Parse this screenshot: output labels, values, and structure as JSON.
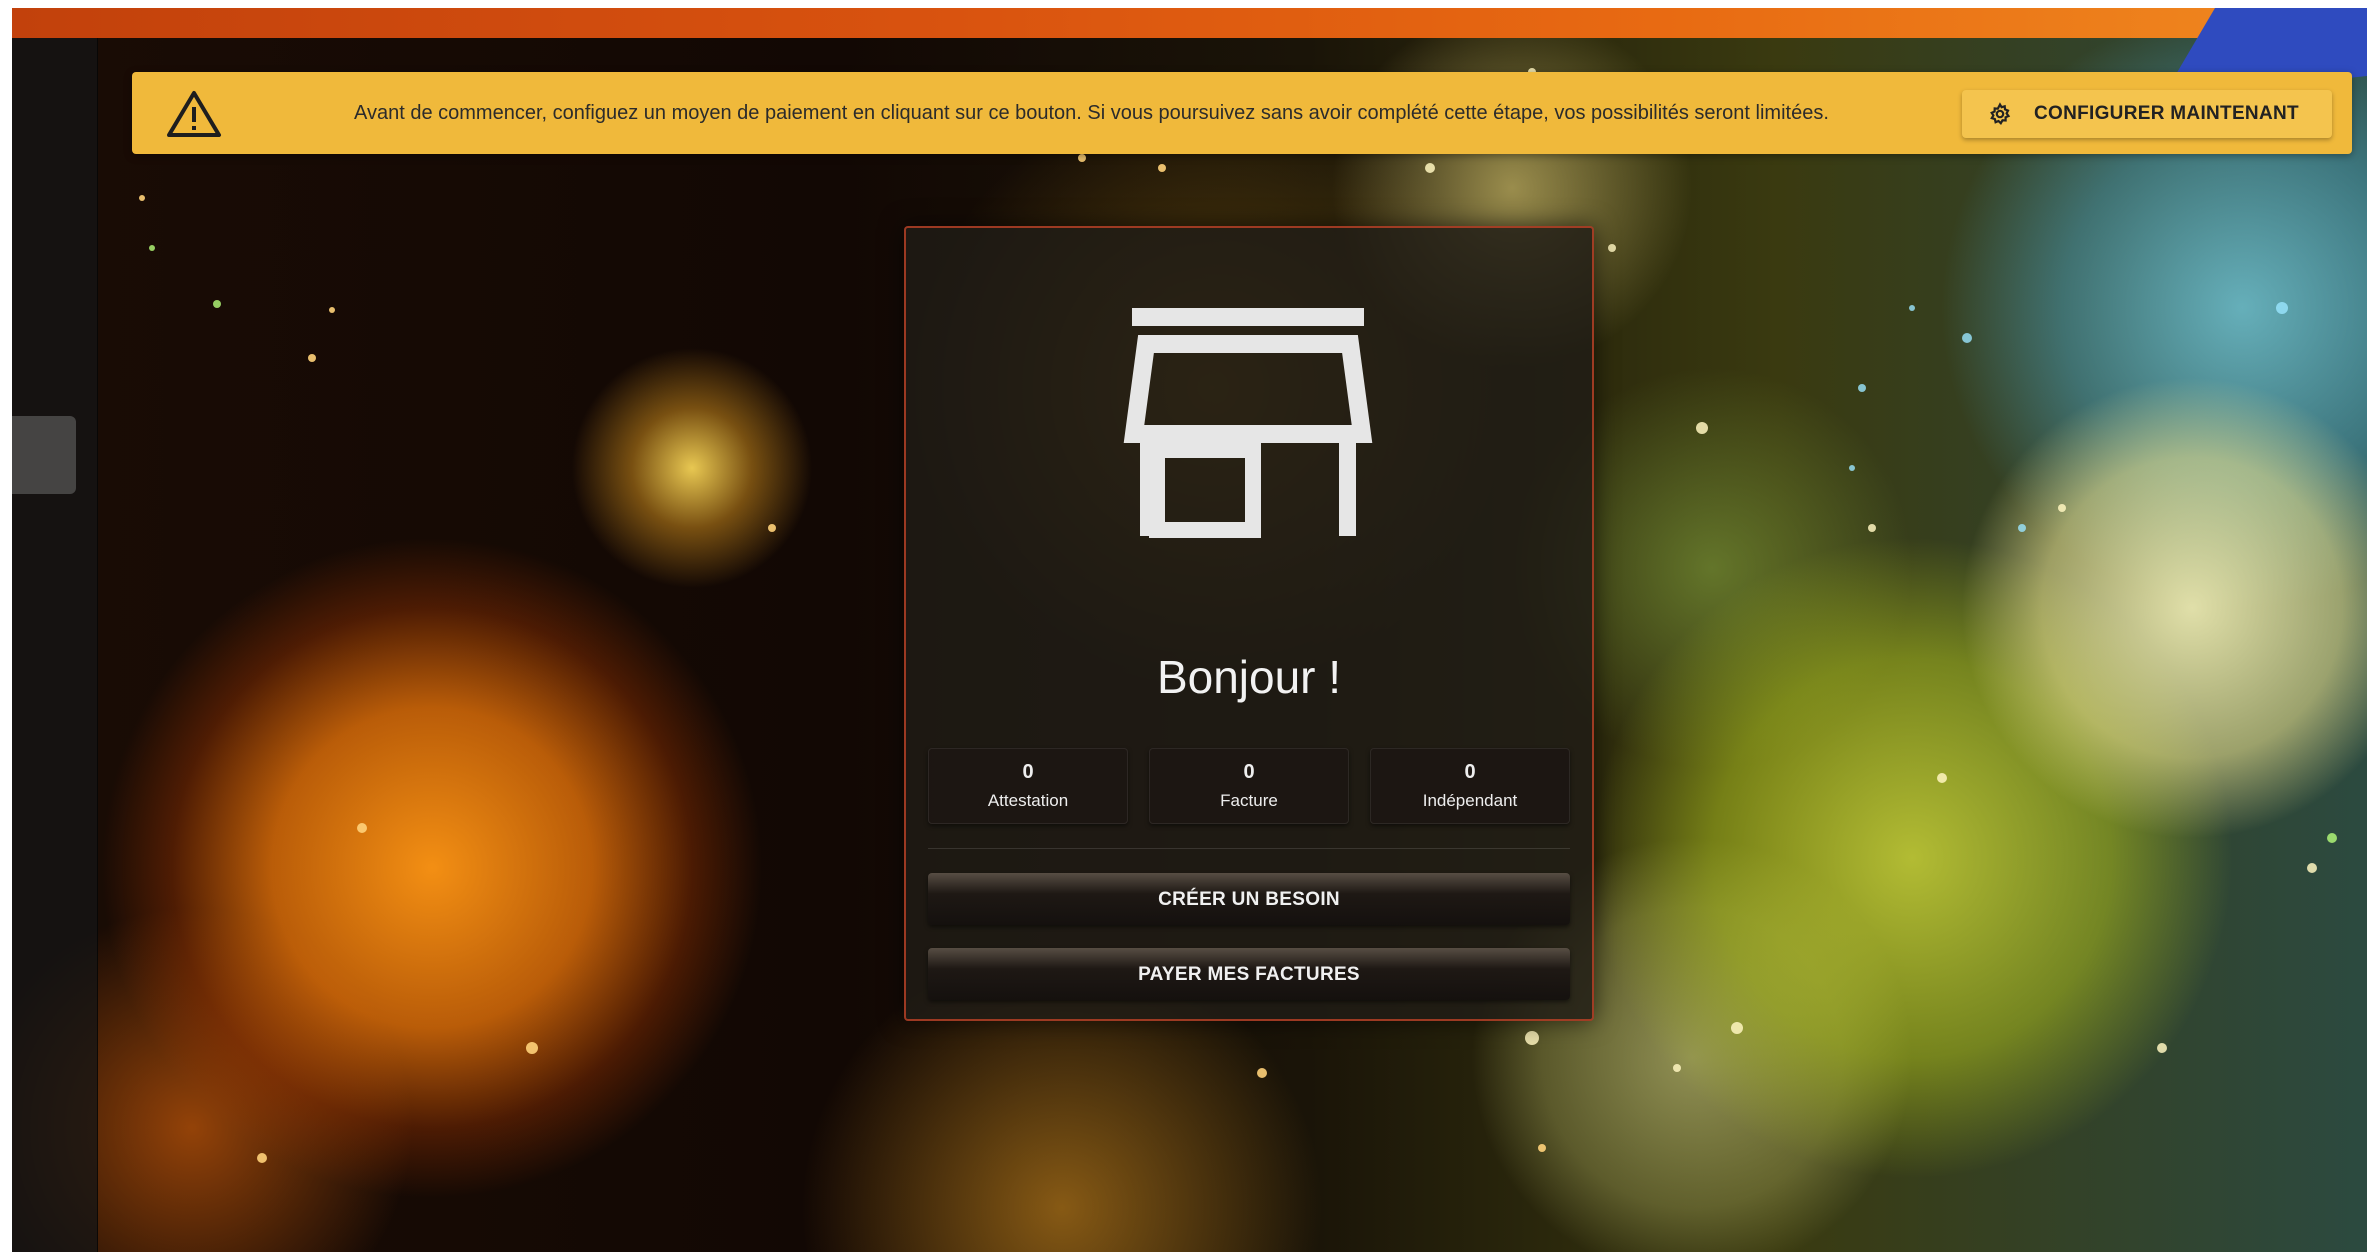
{
  "colors": {
    "banner_bg": "#f0b93b",
    "top_bar": "#d9530f",
    "corner_accent": "#2f4bbf",
    "card_border": "#c84628"
  },
  "banner": {
    "icon": "warning-triangle-icon",
    "message": "Avant de commencer, configuez un moyen de paiement en cliquant sur ce bouton. Si vous poursuivez sans avoir complété cette étape, vos possibilités seront limitées.",
    "button_icon": "gear-icon",
    "button_label": "CONFIGURER MAINTENANT"
  },
  "card": {
    "icon": "storefront-icon",
    "greeting": "Bonjour !",
    "stats": [
      {
        "value": "0",
        "label": "Attestation"
      },
      {
        "value": "0",
        "label": "Facture"
      },
      {
        "value": "0",
        "label": "Indépendant"
      }
    ],
    "actions": {
      "create_need": "CRÉER UN BESOIN",
      "pay_invoices": "PAYER MES FACTURES"
    }
  }
}
